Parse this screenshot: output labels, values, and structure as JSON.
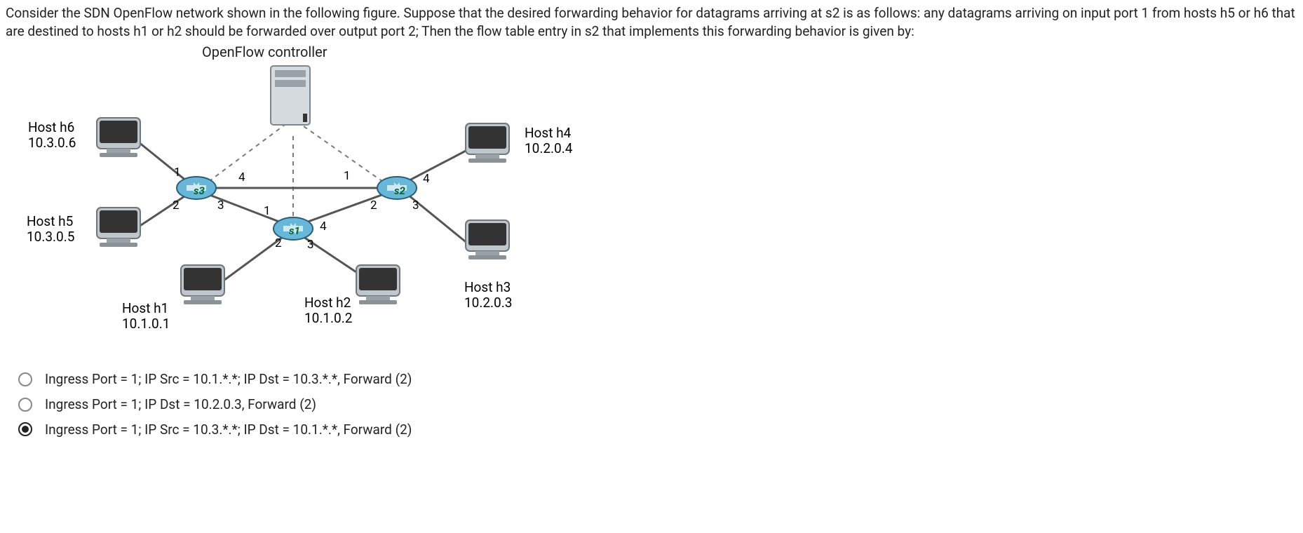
{
  "question": "Consider the SDN OpenFlow network shown in the following figure. Suppose that the desired forwarding behavior for datagrams arriving at s2 is as follows: any datagrams arriving on input port 1 from hosts h5 or h6 that are destined to hosts h1 or h2 should be forwarded over output port 2; Then the flow table entry in s2 that implements this forwarding behavior is given by:",
  "controller_label": "OpenFlow controller",
  "hosts": {
    "h6": {
      "name": "Host h6",
      "ip": "10.3.0.6"
    },
    "h5": {
      "name": "Host h5",
      "ip": "10.3.0.5"
    },
    "h4": {
      "name": "Host h4",
      "ip": "10.2.0.4"
    },
    "h3": {
      "name": "Host h3",
      "ip": "10.2.0.3"
    },
    "h1": {
      "name": "Host h1",
      "ip": "10.1.0.1"
    },
    "h2": {
      "name": "Host h2",
      "ip": "10.1.0.2"
    }
  },
  "switches": {
    "s1": "s1",
    "s2": "s2",
    "s3": "s3"
  },
  "ports": {
    "p1": "1",
    "p2": "2",
    "p3": "3",
    "p4": "4"
  },
  "options": [
    {
      "selected": false,
      "text": "Ingress Port = 1; IP Src = 10.1.*.*; IP Dst = 10.3.*.*, Forward (2)"
    },
    {
      "selected": false,
      "text": "Ingress Port = 1; IP Dst = 10.2.0.3, Forward (2)"
    },
    {
      "selected": true,
      "text": "Ingress Port = 1; IP Src = 10.3.*.*; IP Dst = 10.1.*.*, Forward (2)"
    }
  ]
}
